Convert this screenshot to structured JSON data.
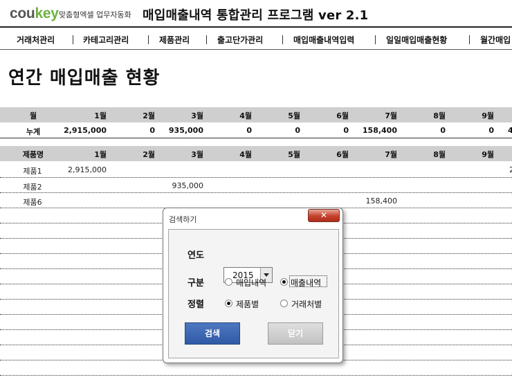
{
  "header": {
    "brand_co": "cou",
    "brand_key": "key",
    "tagline": "맞춤형엑셀 업무자동화",
    "app_title": "매입매출내역 통합관리 프로그램 ver 2.1"
  },
  "nav": {
    "items": [
      "거래처관리",
      "카테고리관리",
      "제품관리",
      "출고단가관리",
      "매입매출내역입력",
      "일일매입매출현황",
      "월간매입"
    ]
  },
  "page": {
    "title": "연간 매입매출 현황"
  },
  "summary_table": {
    "headers": [
      "월",
      "1월",
      "2월",
      "3월",
      "4월",
      "5월",
      "6월",
      "7월",
      "8월",
      "9월"
    ],
    "row_label": "누계",
    "values": [
      "2,915,000",
      "0",
      "935,000",
      "0",
      "0",
      "0",
      "158,400",
      "0",
      "0",
      "4"
    ]
  },
  "product_table": {
    "headers": [
      "제품명",
      "1월",
      "2월",
      "3월",
      "4월",
      "5월",
      "6월",
      "7월",
      "8월",
      "9월"
    ],
    "rows": [
      {
        "name": "제품1",
        "m1": "2,915,000",
        "m3": "",
        "m7": "",
        "edge": "2"
      },
      {
        "name": "제품2",
        "m1": "",
        "m3": "935,000",
        "m7": "",
        "edge": ""
      },
      {
        "name": "제품6",
        "m1": "",
        "m3": "",
        "m7": "158,400",
        "edge": ""
      }
    ]
  },
  "dialog": {
    "title": "검색하기",
    "year_label": "연도",
    "year_value": "2015",
    "type_label": "구분",
    "type_options": [
      "매입내역",
      "매출내역"
    ],
    "type_selected": "매출내역",
    "sort_label": "정렬",
    "sort_options": [
      "제품별",
      "거래처별"
    ],
    "sort_selected": "제품별",
    "search_button": "검색",
    "close_button": "닫기",
    "close_glyph": "✕"
  },
  "colors": {
    "header_bg": "#cfcfcf",
    "brand_green": "#6db33f",
    "search_button": "#2f5aa6",
    "close_x": "#c5412b"
  }
}
